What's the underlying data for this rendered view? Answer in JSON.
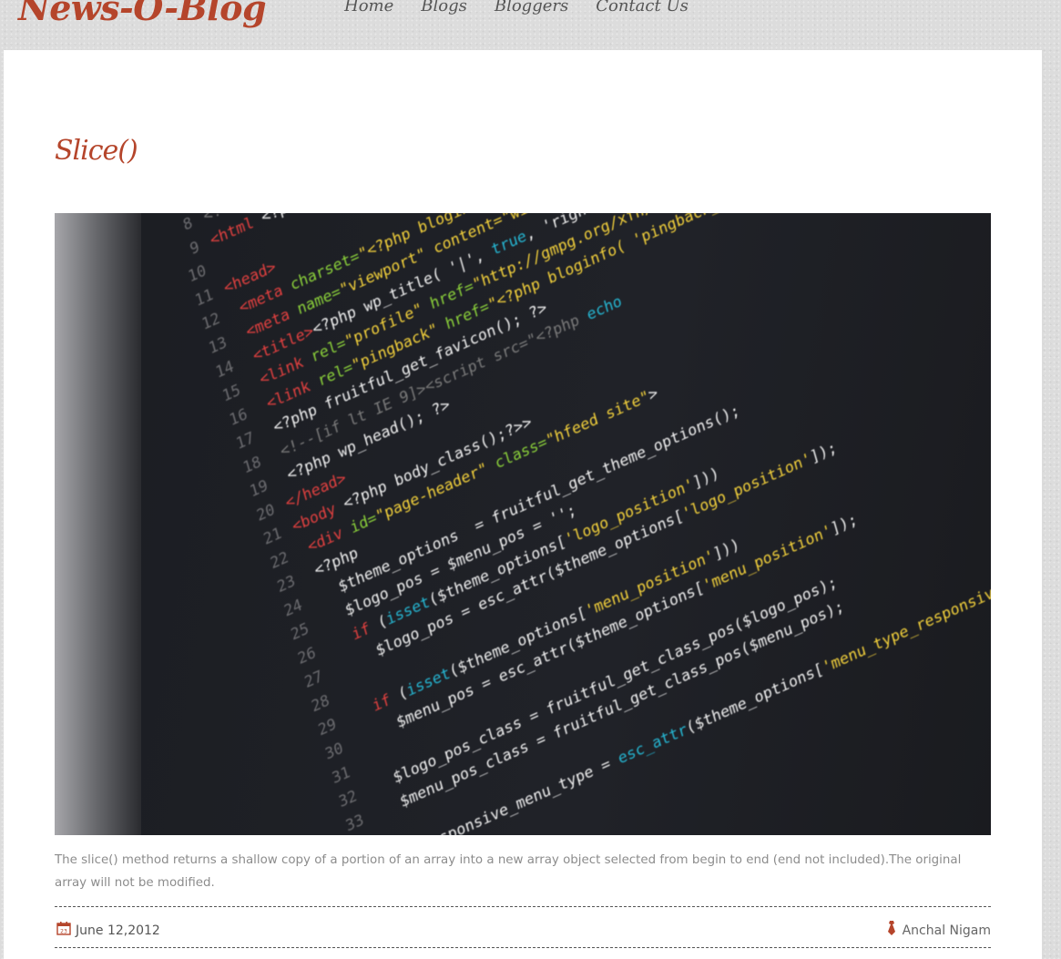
{
  "site": {
    "logo": "News-O-Blog"
  },
  "nav": {
    "items": [
      "Home",
      "Blogs",
      "Bloggers",
      "Contact Us"
    ]
  },
  "post": {
    "title": "Slice()",
    "image_alt_icon": "code-screenshot-image",
    "description": "The slice() method returns a shallow copy of a portion of an array into a new array object selected from begin to end (end not included).The original array will not be modified.",
    "date": "June 12,2012",
    "author": "Anchal Nigam",
    "date_icon": "calendar-icon",
    "author_icon": "tie-icon"
  },
  "colors": {
    "accent": "#b5452b",
    "nav_text": "#555555",
    "body_text": "#8c8c8c"
  }
}
